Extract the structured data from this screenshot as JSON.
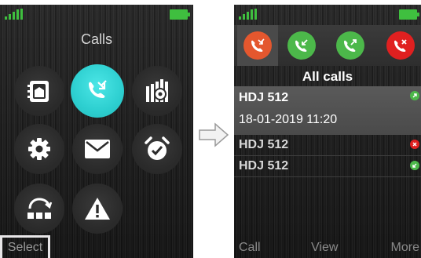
{
  "left_screen": {
    "title": "Calls",
    "menu_items": [
      {
        "icon": "contacts-book-icon"
      },
      {
        "icon": "calls-icon",
        "selected": true
      },
      {
        "icon": "settings-panel-icon"
      },
      {
        "icon": "gear-icon"
      },
      {
        "icon": "envelope-icon"
      },
      {
        "icon": "alarm-clock-icon"
      },
      {
        "icon": "network-share-icon"
      },
      {
        "icon": "warning-icon"
      }
    ],
    "softkey_left": "Select"
  },
  "right_screen": {
    "tabs": [
      {
        "icon": "all-calls-icon",
        "color": "#e4572e",
        "active": true
      },
      {
        "icon": "incoming-call-icon",
        "color": "#4cb84a"
      },
      {
        "icon": "outgoing-call-icon",
        "color": "#4cb84a"
      },
      {
        "icon": "missed-call-icon",
        "color": "#e02020"
      }
    ],
    "heading": "All calls",
    "selected_call": {
      "name": "HDJ 512",
      "datetime": "18-01-2019 11:20",
      "status_icon": "outgoing-status-icon"
    },
    "calls": [
      {
        "name": "HDJ 512",
        "status_icon": "missed-status-icon",
        "status_color": "#e02020"
      },
      {
        "name": "HDJ 512",
        "status_icon": "incoming-status-icon",
        "status_color": "#4cb84a"
      }
    ],
    "softkeys": {
      "left": "Call",
      "middle": "View",
      "right": "More"
    }
  },
  "colors": {
    "signal": "#3fbf3f",
    "battery": "#3fbf3f",
    "accent": "#2dcfd0"
  }
}
